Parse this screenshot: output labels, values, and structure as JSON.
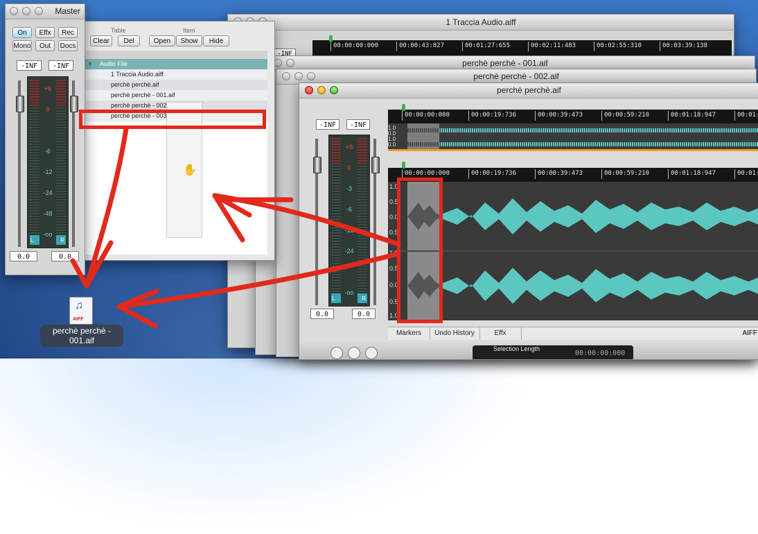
{
  "master": {
    "title": "Master",
    "buttons": [
      "On",
      "Effx",
      "Rec",
      "Mono",
      "Out",
      "Docs"
    ],
    "db_left": "-INF",
    "db_right": "-INF",
    "scale": [
      "+6",
      "0",
      "-6",
      "-12",
      "-24",
      "-48",
      "-oo"
    ],
    "level_left": "0.0",
    "level_right": "0.0",
    "ch_left": "L",
    "ch_right": "R"
  },
  "browser": {
    "group_table": "Table",
    "group_item": "Item",
    "buttons": [
      "Clear",
      "Del",
      "Open",
      "Show",
      "Hide"
    ],
    "list_header": "Audio File",
    "files": [
      "1 Traccia Audio.aiff",
      "perchè perchè.aif",
      "perchè perchè - 001.aif",
      "perchè perchè - 002.aif",
      "perchè perchè - 003.aif"
    ]
  },
  "bg_window": {
    "title": "1 Traccia Audio.aiff",
    "side_db": "-INF",
    "ruler": [
      "00:00:00:000",
      "00:00:43:827",
      "00:01:27:655",
      "00:02:11:483",
      "00:02:55:310",
      "00:03:39:138"
    ]
  },
  "window_001": {
    "title": "perchè perchè - 001.aif"
  },
  "window_002": {
    "title": "perchè perchè - 002.aif"
  },
  "front_window": {
    "title": "perchè perchè.aif",
    "db_left": "-INF",
    "db_right": "-INF",
    "scale": [
      "+6",
      "0",
      "-3",
      "-6",
      "-12",
      "-24",
      "-oo"
    ],
    "level_left": "0.0",
    "level_right": "0.0",
    "ch_left": "L",
    "ch_right": "R",
    "ruler": [
      "00:00:00:000",
      "00:00:19:736",
      "00:00:39:473",
      "00:00:59:210",
      "00:01:18:947",
      "00:01:"
    ],
    "overview_y": [
      "1.0",
      "0.0",
      "1.0",
      "0.0",
      "1.0"
    ],
    "main_y": [
      "1.0",
      "0.5",
      "0.0",
      "0.5",
      "1.0",
      "0.5",
      "0.0",
      "0.5",
      "1.0"
    ],
    "tabs": [
      "Markers",
      "Undo History",
      "Effx"
    ],
    "format": "AIFF",
    "selection_label": "Selection Length",
    "selection_value": "00:00:00:000"
  },
  "desktop_file": {
    "name_line1": "perchè perchè -",
    "name_line2": "001.aif",
    "badge": "AIFF"
  },
  "colors": {
    "waveform": "#5cc7c0",
    "annotation": "#e3281c",
    "list_header": "#7ab3b4"
  }
}
